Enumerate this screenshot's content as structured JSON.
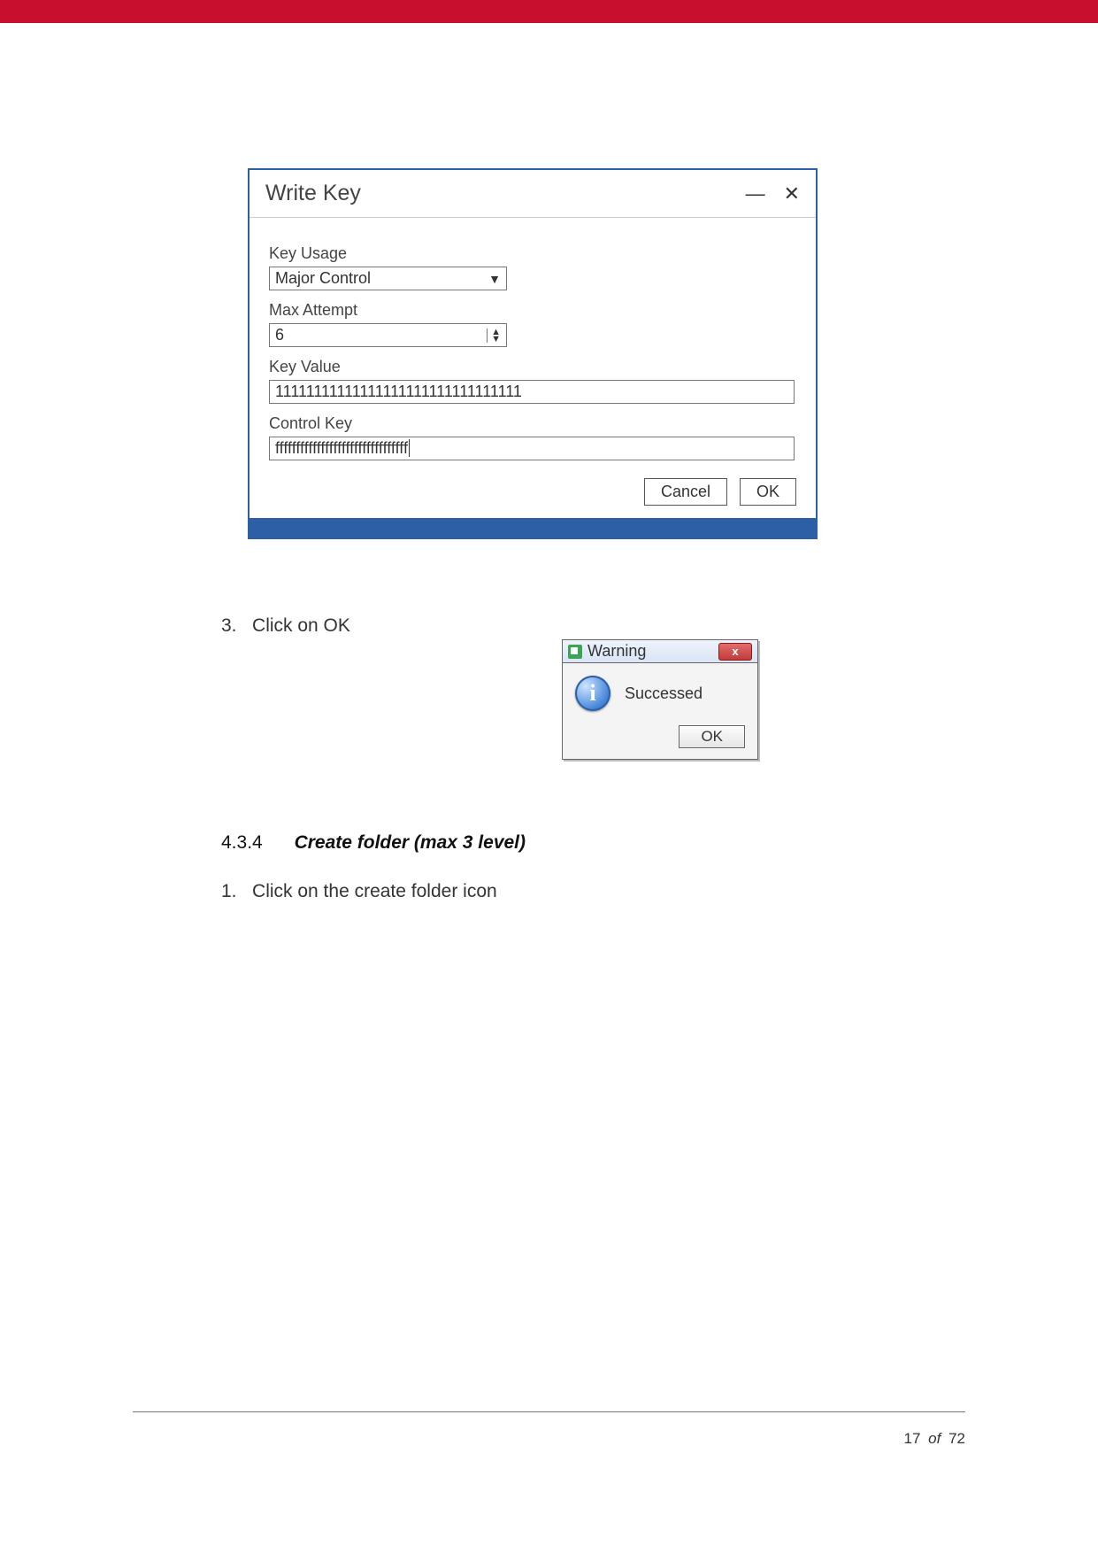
{
  "write_dialog": {
    "title": "Write Key",
    "labels": {
      "key_usage": "Key Usage",
      "max_attempt": "Max Attempt",
      "key_value": "Key Value",
      "control_key": "Control Key"
    },
    "key_usage_value": "Major Control",
    "max_attempt_value": "6",
    "key_value_value": "11111111111111111111111111111111",
    "control_key_value": "ffffffffffffffffffffffffffffffff",
    "buttons": {
      "cancel": "Cancel",
      "ok": "OK"
    }
  },
  "steps": {
    "three_nr": "3.",
    "three_text": "Click on OK",
    "section_nr": "4.3.4",
    "section_title": "Create folder (max 3 level)",
    "one_nr": "1.",
    "one_text": "Click on the create folder icon"
  },
  "popup": {
    "title": "Warning",
    "message": "Successed",
    "ok": "OK",
    "info_glyph": "i"
  },
  "footer": {
    "page": "17",
    "of": "of",
    "total": "72"
  }
}
